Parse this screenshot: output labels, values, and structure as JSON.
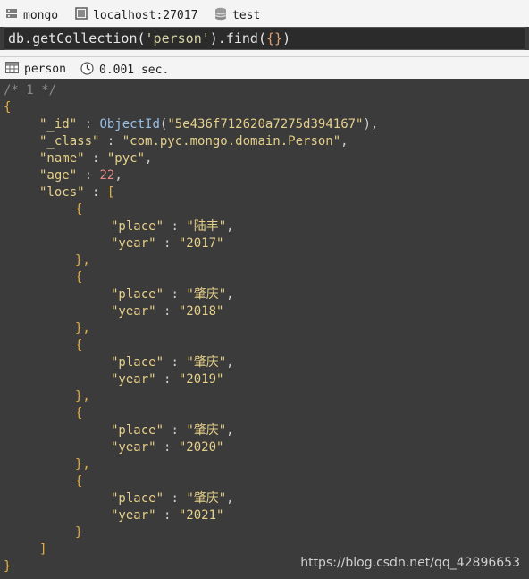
{
  "breadcrumb": {
    "db_type": "mongo",
    "server": "localhost:27017",
    "database": "test",
    "icons": [
      "server-icon",
      "host-icon",
      "database-icon"
    ]
  },
  "query": {
    "prefix": "db.getCollection(",
    "collection_arg": "'person'",
    "middle": ").find(",
    "filter": "{}",
    "suffix": ")"
  },
  "result_bar": {
    "collection": "person",
    "elapsed": "0.001 sec.",
    "icons": [
      "table-icon",
      "clock-icon"
    ]
  },
  "result": {
    "comment": "/* 1 */",
    "doc": {
      "_id": "ObjectId(\"5e436f712620a7275d394167\")",
      "_id_func": "ObjectId",
      "_id_value": "\"5e436f712620a7275d394167\"",
      "_class": "\"com.pyc.mongo.domain.Person\"",
      "name": "\"pyc\"",
      "age": "22",
      "locs": [
        {
          "place": "\"陆丰\"",
          "year": "\"2017\""
        },
        {
          "place": "\"肇庆\"",
          "year": "\"2018\""
        },
        {
          "place": "\"肇庆\"",
          "year": "\"2019\""
        },
        {
          "place": "\"肇庆\"",
          "year": "\"2020\""
        },
        {
          "place": "\"肇庆\"",
          "year": "\"2021\""
        }
      ]
    },
    "keys": {
      "id": "\"_id\"",
      "class": "\"_class\"",
      "name": "\"name\"",
      "age": "\"age\"",
      "locs": "\"locs\"",
      "place": "\"place\"",
      "year": "\"year\""
    }
  },
  "watermark": "https://blog.csdn.net/qq_42896653"
}
